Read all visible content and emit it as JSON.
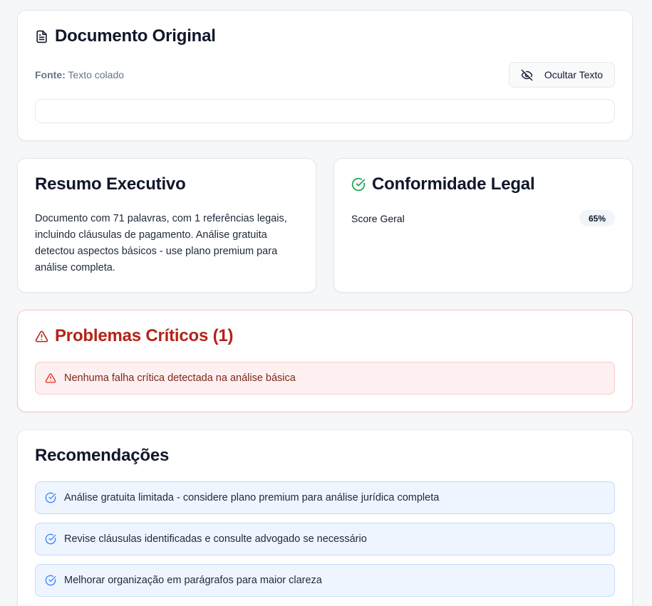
{
  "document": {
    "title": "Documento Original",
    "source_label": "Fonte:",
    "source_value": "Texto colado",
    "hide_button": "Ocultar Texto",
    "text": ""
  },
  "summary": {
    "title": "Resumo Executivo",
    "text": "Documento com 71 palavras, com 1 referências legais, incluindo cláusulas de pagamento. Análise gratuita detectou aspectos básicos - use plano premium para análise completa."
  },
  "compliance": {
    "title": "Conformidade Legal",
    "score_label": "Score Geral",
    "score_value": "65%"
  },
  "critical": {
    "title": "Problemas Críticos (1)",
    "items": [
      "Nenhuma falha crítica detectada na análise básica"
    ]
  },
  "recommendations": {
    "title": "Recomendações",
    "items": [
      "Análise gratuita limitada - considere plano premium para análise jurídica completa",
      "Revise cláusulas identificadas e consulte advogado se necessário",
      "Melhorar organização em parágrafos para maior clareza"
    ]
  },
  "icons": {
    "document": "file-text-icon",
    "hide": "eye-off-icon",
    "compliance": "check-circle-icon",
    "critical": "alert-triangle-icon",
    "recommendation": "check-circle-icon"
  },
  "colors": {
    "critical": "#b42318",
    "success": "#16a34a",
    "info": "#3b82f6"
  }
}
